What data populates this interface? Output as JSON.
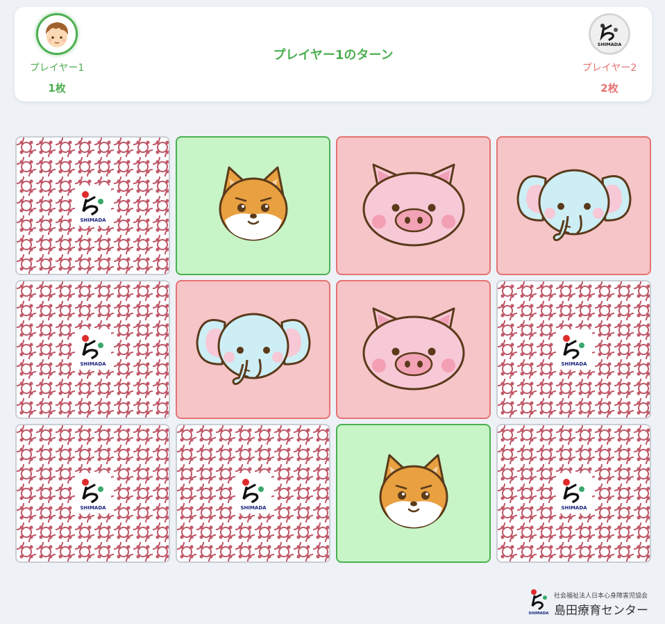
{
  "header": {
    "turn_text": "プレイヤー1のターン",
    "player1": {
      "name": "プレイヤー1",
      "count": "1枚",
      "avatar_icon": "boy-avatar-icon",
      "color": "#4caf50"
    },
    "player2": {
      "name": "プレイヤー2",
      "count": "2枚",
      "avatar_icon": "shimada-logo-icon",
      "color": "#e57373"
    }
  },
  "board": {
    "rows": [
      [
        {
          "state": "face-down"
        },
        {
          "state": "matched-p1",
          "animal": "shiba-dog"
        },
        {
          "state": "matched-p2",
          "animal": "pig"
        },
        {
          "state": "matched-p2",
          "animal": "elephant"
        }
      ],
      [
        {
          "state": "face-down"
        },
        {
          "state": "matched-p2",
          "animal": "elephant"
        },
        {
          "state": "matched-p2",
          "animal": "pig"
        },
        {
          "state": "face-down"
        }
      ],
      [
        {
          "state": "face-down"
        },
        {
          "state": "face-down"
        },
        {
          "state": "matched-p1",
          "animal": "shiba-dog"
        },
        {
          "state": "face-down"
        }
      ]
    ],
    "card_back_logo_text": "SHIMADA"
  },
  "footer": {
    "org_sub": "社会福祉法人日本心身障害児協会",
    "org_name": "島田療育センター"
  },
  "colors": {
    "p1": "#4caf50",
    "p2": "#e57373",
    "p1_bg": "#c8f5c8",
    "p2_bg": "#f6c5c8",
    "card_back_pattern": "#c05a6a"
  }
}
